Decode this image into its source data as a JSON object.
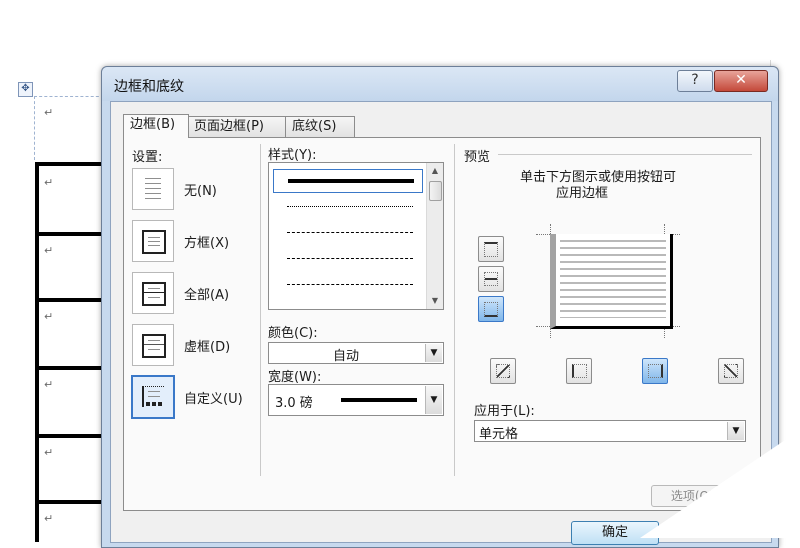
{
  "document": {
    "move_handle_glyph": "✥",
    "paragraph_mark": "↵"
  },
  "dialog": {
    "title": "边框和底纹",
    "help_glyph": "?",
    "close_glyph": "✕",
    "tabs": [
      {
        "label": "边框(B)",
        "active": true
      },
      {
        "label": "页面边框(P)",
        "active": false
      },
      {
        "label": "底纹(S)",
        "active": false
      }
    ],
    "settings": {
      "heading": "设置:",
      "items": [
        {
          "label": "无(N)",
          "selected": false
        },
        {
          "label": "方框(X)",
          "selected": false
        },
        {
          "label": "全部(A)",
          "selected": false
        },
        {
          "label": "虚框(D)",
          "selected": false
        },
        {
          "label": "自定义(U)",
          "selected": true
        }
      ]
    },
    "style": {
      "heading": "样式(Y):",
      "items": [
        "solid-thick",
        "dotted",
        "dashed-fine",
        "dashed",
        "dash-dot"
      ],
      "selected_index": 0
    },
    "color": {
      "heading": "颜色(C):",
      "value": "自动"
    },
    "width": {
      "heading": "宽度(W):",
      "value": "3.0 磅"
    },
    "preview": {
      "heading": "预览",
      "hint_line1": "单击下方图示或使用按钮可",
      "hint_line2": "应用边框"
    },
    "apply_to": {
      "heading": "应用于(L):",
      "value": "单元格"
    },
    "options_button": "选项(O)...",
    "ok_button": "确定",
    "colors": {
      "title_bg": "#c7d9ee",
      "close_bg": "#c4493a",
      "selected_accent": "#3a78c8"
    }
  }
}
